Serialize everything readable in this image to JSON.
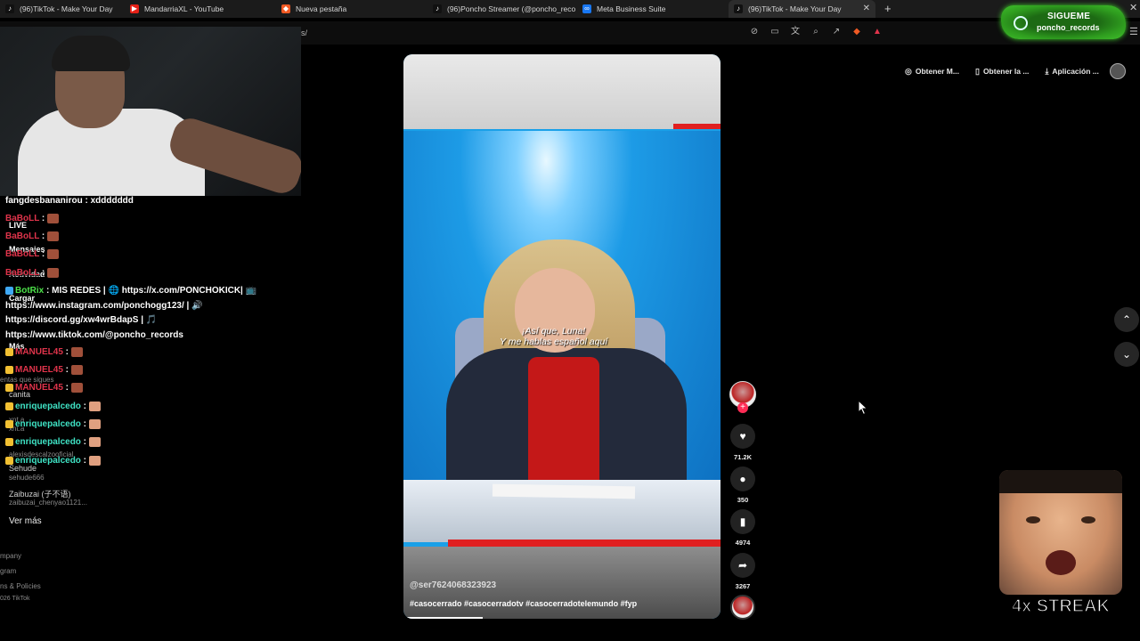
{
  "browser": {
    "tabs": [
      {
        "label": "(96)TikTok - Make Your Day",
        "icon": "tiktok-icon"
      },
      {
        "label": "MandarriaXL - YouTube",
        "icon": "youtube-icon"
      },
      {
        "label": "Nueva pestaña",
        "icon": "brave-icon"
      },
      {
        "label": "(96)Poncho Streamer (@poncho_reco",
        "icon": "tiktok-icon"
      },
      {
        "label": "Meta Business Suite",
        "icon": "meta-icon"
      },
      {
        "label": "(96)TikTok - Make Your Day",
        "icon": "tiktok-icon",
        "active": true
      }
    ],
    "address_suffix": "s/",
    "colors": {
      "tabbar": "#1b1b1b",
      "active_tab": "#2c2c2c"
    }
  },
  "follow_badge": {
    "line1": "SIGUEME",
    "line2": "poncho_records",
    "color": "#2f9d1f"
  },
  "chat": {
    "messages": [
      {
        "user": "fangdesbananirou",
        "text": " : xddddddd",
        "color": "white"
      },
      {
        "user": "BaBoLL",
        "text": " :",
        "color": "red"
      },
      {
        "user": "BaBoLL",
        "text": " :",
        "color": "red"
      },
      {
        "user": "BaBoLL",
        "text": " :",
        "color": "red"
      },
      {
        "user": "BaBoLL",
        "text": " :",
        "color": "red"
      },
      {
        "user": "BotRix",
        "text": " : MIS REDES | 🌐 https://x.com/PONCHOKICK| 📺",
        "color": "green"
      },
      {
        "user": "",
        "text": "https://www.instagram.com/ponchogg123/ | 🔊",
        "color": "white"
      },
      {
        "user": "",
        "text": "https://discord.gg/xw4wrBdapS | 🎵",
        "color": "white"
      },
      {
        "user": "",
        "text": "https://www.tiktok.com/@poncho_records",
        "color": "white"
      },
      {
        "user": "MANUEL45",
        "text": " :",
        "color": "red"
      },
      {
        "user": "MANUEL45",
        "text": " :",
        "color": "red"
      },
      {
        "user": "MANUEL45",
        "text": " :",
        "color": "red"
      },
      {
        "user": "enriquepalcedo",
        "text": " :",
        "color": "cyan"
      },
      {
        "user": "enriquepalcedo",
        "text": " :",
        "color": "cyan"
      },
      {
        "user": "enriquepalcedo",
        "text": " :",
        "color": "cyan"
      },
      {
        "user": "enriquepalcedo",
        "text": " :",
        "color": "cyan"
      }
    ]
  },
  "tiktok_sidebar": {
    "items": [
      "LIVE",
      "Mensajes",
      "Actividad",
      "Cargar",
      "Más"
    ],
    "following_label": "entas que sigues",
    "accounts": [
      {
        "name": "canita",
        "handle": "xnt.a"
      },
      {
        "name": "",
        "handle": "xnt.a"
      },
      {
        "name": "",
        "handle": "alexisdescalzooficial"
      },
      {
        "name": "Sehude",
        "handle": "sehude666"
      },
      {
        "name": "Zaibuzai (子不语)",
        "handle": "zaibuzai_chenyao1121..."
      }
    ],
    "see_more": "Ver más",
    "footer": [
      "mpany",
      "gram",
      "ns & Policies",
      "026 TikTok"
    ]
  },
  "video": {
    "caption_line1": "¡Así que, Luna!",
    "caption_line2": "Y me hablas español aquí",
    "username": "@ser7624068323923",
    "hashtags": "#casocerrado #casocerradotv #casocerradotelemundo #fyp",
    "progress": 0.25
  },
  "actions": {
    "likes": "71.2K",
    "comments": "350",
    "saves": "4974",
    "shares": "3267"
  },
  "top_buttons": [
    {
      "label": "Obtener M...",
      "icon": "coins-icon"
    },
    {
      "label": "Obtener la ...",
      "icon": "phone-icon"
    },
    {
      "label": "Aplicación ...",
      "icon": "download-icon"
    }
  ],
  "streak": {
    "label": "4x STREAK"
  }
}
